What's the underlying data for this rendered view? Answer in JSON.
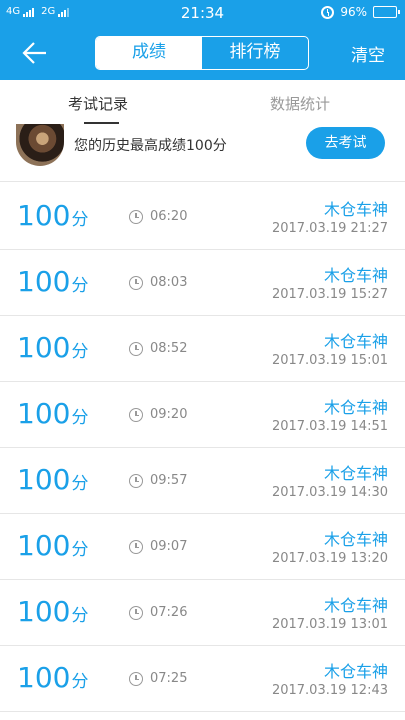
{
  "status_bar": {
    "network_1": "4G",
    "network_2": "2G",
    "time": "21:34",
    "battery": "96%",
    "battery_level": 0.96
  },
  "header": {
    "back_icon": "arrow-left-icon",
    "tabs": [
      {
        "label": "成绩",
        "active": true
      },
      {
        "label": "排行榜",
        "active": false
      }
    ],
    "clear_label": "清空"
  },
  "sub_tabs": [
    {
      "label": "考试记录",
      "active": true
    },
    {
      "label": "数据统计",
      "active": false
    }
  ],
  "best": {
    "text": "您的历史最高成绩100分",
    "button_label": "去考试"
  },
  "colors": {
    "accent": "#1aa0e8",
    "text_muted": "#888888"
  },
  "records": [
    {
      "score": "100",
      "unit": "分",
      "duration": "06:20",
      "name": "木仓车神",
      "date": "2017.03.19   21:27"
    },
    {
      "score": "100",
      "unit": "分",
      "duration": "08:03",
      "name": "木仓车神",
      "date": "2017.03.19   15:27"
    },
    {
      "score": "100",
      "unit": "分",
      "duration": "08:52",
      "name": "木仓车神",
      "date": "2017.03.19   15:01"
    },
    {
      "score": "100",
      "unit": "分",
      "duration": "09:20",
      "name": "木仓车神",
      "date": "2017.03.19   14:51"
    },
    {
      "score": "100",
      "unit": "分",
      "duration": "09:57",
      "name": "木仓车神",
      "date": "2017.03.19   14:30"
    },
    {
      "score": "100",
      "unit": "分",
      "duration": "09:07",
      "name": "木仓车神",
      "date": "2017.03.19   13:20"
    },
    {
      "score": "100",
      "unit": "分",
      "duration": "07:26",
      "name": "木仓车神",
      "date": "2017.03.19   13:01"
    },
    {
      "score": "100",
      "unit": "分",
      "duration": "07:25",
      "name": "木仓车神",
      "date": "2017.03.19   12:43"
    }
  ]
}
